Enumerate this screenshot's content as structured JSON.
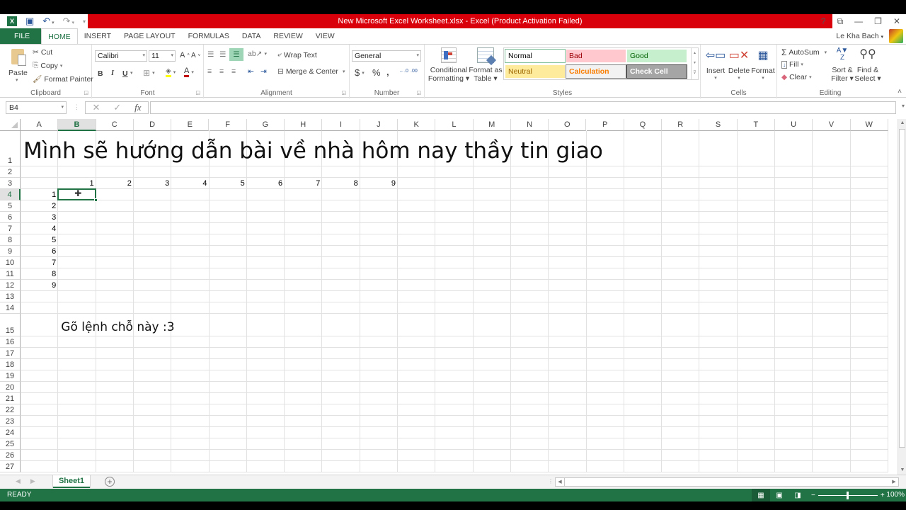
{
  "window": {
    "title": "New Microsoft Excel Worksheet.xlsx -  Excel (Product Activation Failed)",
    "controls": {
      "help": "?",
      "ribbon_display": "⧉",
      "minimize": "—",
      "restore": "❐",
      "close": "✕"
    }
  },
  "qat": {
    "app_icon": "X≡",
    "save": "💾",
    "undo": "↶",
    "redo": "↷",
    "customize": "▾"
  },
  "tabs": [
    "FILE",
    "HOME",
    "INSERT",
    "PAGE LAYOUT",
    "FORMULAS",
    "DATA",
    "REVIEW",
    "VIEW"
  ],
  "active_tab": "HOME",
  "user": {
    "name": "Le Kha Bach",
    "dropdown": "▾"
  },
  "ribbon": {
    "clipboard": {
      "label": "Clipboard",
      "paste": "Paste",
      "cut": "Cut",
      "copy": "Copy",
      "format_painter": "Format Painter"
    },
    "font": {
      "label": "Font",
      "font_name": "Calibri",
      "font_size": "11",
      "grow": "A˄",
      "shrink": "A˅",
      "bold": "B",
      "italic": "I",
      "underline": "U",
      "font_color_hex": "#c00000",
      "fill_color_hex": "#ffff00"
    },
    "alignment": {
      "label": "Alignment",
      "wrap_text": "Wrap Text",
      "merge_center": "Merge & Center"
    },
    "number": {
      "label": "Number",
      "format": "General",
      "currency": "$",
      "percent": "%",
      "comma": ",",
      "inc_decimal": "←.0",
      "dec_decimal": ".00→"
    },
    "styles": {
      "label": "Styles",
      "conditional_formatting": [
        "Conditional",
        "Formatting ▾"
      ],
      "format_as_table": [
        "Format as",
        "Table ▾"
      ],
      "cells": [
        {
          "name": "Normal",
          "bg": "#ffffff",
          "fg": "#000000",
          "border": "#7fbf9a"
        },
        {
          "name": "Bad",
          "bg": "#ffc7ce",
          "fg": "#9c0006"
        },
        {
          "name": "Good",
          "bg": "#c6efce",
          "fg": "#006100"
        },
        {
          "name": "Neutral",
          "bg": "#ffeb9c",
          "fg": "#9c6500"
        },
        {
          "name": "Calculation",
          "bg": "#f2f2f2",
          "fg": "#fa7d00",
          "border": "#7f7f7f"
        },
        {
          "name": "Check Cell",
          "bg": "#a5a5a5",
          "fg": "#ffffff",
          "border": "#3f3f3f"
        }
      ]
    },
    "cells": {
      "label": "Cells",
      "insert": "Insert",
      "delete": "Delete",
      "format": "Format"
    },
    "editing": {
      "label": "Editing",
      "autosum": "AutoSum",
      "fill": "Fill",
      "clear": "Clear",
      "sort_filter": [
        "Sort &",
        "Filter ▾"
      ],
      "find_select": [
        "Find &",
        "Select ▾"
      ]
    }
  },
  "formula_bar": {
    "name_box": "B4",
    "cancel": "✕",
    "enter": "✓",
    "fx": "fx",
    "formula": ""
  },
  "grid": {
    "columns": [
      "A",
      "B",
      "C",
      "D",
      "E",
      "F",
      "G",
      "H",
      "I",
      "J",
      "K",
      "L",
      "M",
      "N",
      "O",
      "P",
      "Q",
      "R",
      "S",
      "T",
      "U",
      "V",
      "W"
    ],
    "selected_column": "B",
    "selected_row": 4,
    "rows": [
      1,
      2,
      3,
      4,
      5,
      6,
      7,
      8,
      9,
      10,
      11,
      12,
      13,
      14,
      15,
      16,
      17,
      18,
      19,
      20,
      21,
      22,
      23,
      24,
      25,
      26,
      27
    ],
    "active_cell": "B4",
    "cells": {
      "A1": "Mình sẽ hướng dẫn bài về nhà hôm nay thầy tin giao",
      "B3": "1",
      "C3": "2",
      "D3": "3",
      "E3": "4",
      "F3": "5",
      "G3": "6",
      "H3": "7",
      "I3": "8",
      "J3": "9",
      "A4": "1",
      "A5": "2",
      "A6": "3",
      "A7": "4",
      "A8": "5",
      "A9": "6",
      "A10": "7",
      "A11": "8",
      "A12": "9",
      "B15": "Gõ lệnh chỗ này :3"
    }
  },
  "sheets": {
    "tabs": [
      "Sheet1"
    ],
    "active": "Sheet1",
    "add": "+"
  },
  "status": {
    "mode": "READY",
    "zoom": "100%",
    "zoom_fraction": 0.5
  }
}
